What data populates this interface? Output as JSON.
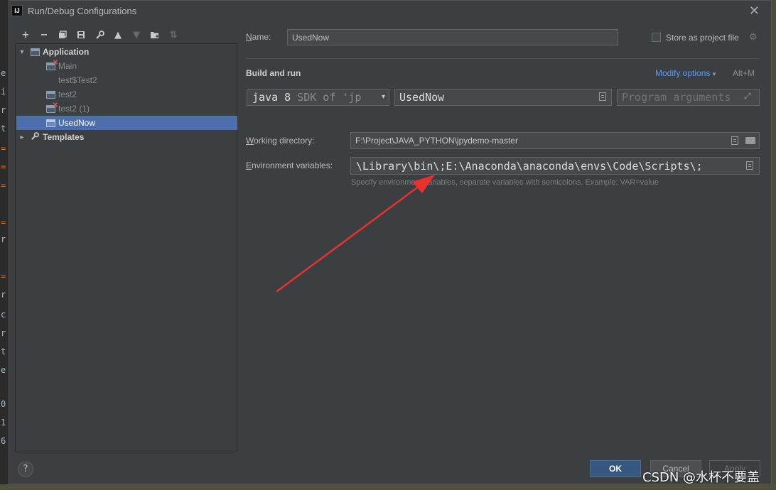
{
  "window": {
    "title": "Run/Debug Configurations",
    "app_icon_text": "IJ"
  },
  "background": {
    "left_strip_chars": [
      "e",
      "i",
      "r",
      "t",
      "=",
      "=",
      "=",
      "=",
      "r",
      "=",
      "r",
      "c",
      "r",
      "t",
      "e",
      "0",
      "1",
      "6"
    ]
  },
  "toolbar": {
    "buttons": [
      "add-icon",
      "remove-icon",
      "copy-icon",
      "save-icon",
      "wrench-icon",
      "move-up-icon",
      "move-down-icon",
      "new-folder-icon",
      "sort-icon"
    ]
  },
  "tree": {
    "application": "Application",
    "items": [
      {
        "label": "Main",
        "error": true
      },
      {
        "label": "test$Test2",
        "error": false
      },
      {
        "label": "test2",
        "error": false
      },
      {
        "label": "test2 (1)",
        "error": true
      },
      {
        "label": "UsedNow",
        "selected": true
      }
    ],
    "templates": "Templates"
  },
  "form": {
    "name_label": "Name:",
    "name_value": "UsedNow",
    "store_label": "Store as project file",
    "section_title": "Build and run",
    "modify_options": "Modify options",
    "modify_shortcut": "Alt+M",
    "sdk_value": "java 8",
    "sdk_hint": "SDK of 'jp",
    "main_class_value": "UsedNow",
    "program_args_placeholder": "Program arguments",
    "working_dir_label": "Working directory:",
    "working_dir_value": "F:\\Project\\JAVA_PYTHON\\jpydemo-master",
    "env_label": "Environment variables:",
    "env_value": "\\Library\\bin\\;E:\\Anaconda\\anaconda\\envs\\Code\\Scripts\\;",
    "env_hint": "Specify environment variables, separate variables with semicolons. Example: VAR=value"
  },
  "footer": {
    "help": "?",
    "ok": "OK",
    "cancel": "Cancel",
    "apply": "Apply"
  },
  "watermark": "CSDN @水杯不要盖",
  "colors": {
    "dialog_bg": "#3c3f41",
    "selection": "#4b6eaf",
    "link": "#589df6",
    "error": "#e05555",
    "annotation_arrow": "#e8322d"
  }
}
